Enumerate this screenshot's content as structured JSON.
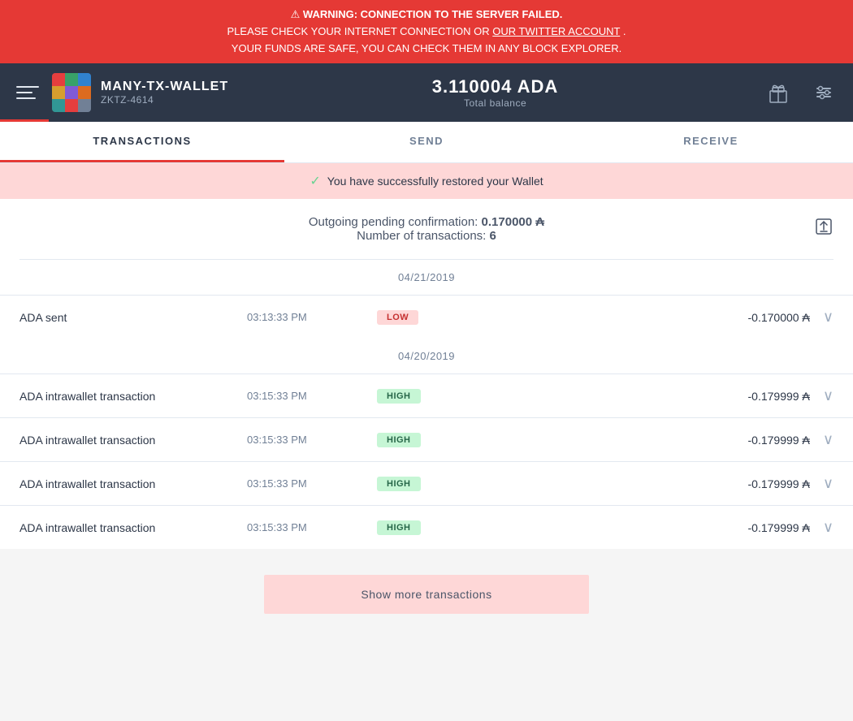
{
  "warning": {
    "icon": "⚠",
    "title": "WARNING: CONNECTION TO THE SERVER FAILED.",
    "line2_prefix": "PLEASE CHECK YOUR INTERNET CONNECTION OR ",
    "line2_link": "OUR TWITTER ACCOUNT",
    "line2_suffix": ".",
    "line3": "YOUR FUNDS ARE SAFE, YOU CAN CHECK THEM IN ANY BLOCK EXPLORER."
  },
  "header": {
    "wallet_name": "MANY-TX-WALLET",
    "wallet_id": "ZKTZ-4614",
    "balance": "3.110004 ADA",
    "balance_label": "Total balance"
  },
  "nav": {
    "tabs": [
      {
        "id": "transactions",
        "label": "TRANSACTIONS",
        "active": true
      },
      {
        "id": "send",
        "label": "SEND",
        "active": false
      },
      {
        "id": "receive",
        "label": "RECEIVE",
        "active": false
      }
    ]
  },
  "success_banner": {
    "message": "You have successfully restored your Wallet"
  },
  "pending": {
    "label": "Outgoing pending confirmation:",
    "amount": "0.170000",
    "ada_symbol": "₳",
    "tx_label": "Number of transactions:",
    "tx_count": "6"
  },
  "date_groups": [
    {
      "date": "04/21/2019",
      "transactions": [
        {
          "name": "ADA sent",
          "time": "03:13:33 PM",
          "badge": "LOW",
          "badge_type": "low",
          "amount": "-0.170000 ₳"
        }
      ]
    },
    {
      "date": "04/20/2019",
      "transactions": [
        {
          "name": "ADA intrawallet transaction",
          "time": "03:15:33 PM",
          "badge": "HIGH",
          "badge_type": "high",
          "amount": "-0.179999 ₳"
        },
        {
          "name": "ADA intrawallet transaction",
          "time": "03:15:33 PM",
          "badge": "HIGH",
          "badge_type": "high",
          "amount": "-0.179999 ₳"
        },
        {
          "name": "ADA intrawallet transaction",
          "time": "03:15:33 PM",
          "badge": "HIGH",
          "badge_type": "high",
          "amount": "-0.179999 ₳"
        },
        {
          "name": "ADA intrawallet transaction",
          "time": "03:15:33 PM",
          "badge": "HIGH",
          "badge_type": "high",
          "amount": "-0.179999 ₳"
        }
      ]
    }
  ],
  "show_more_btn": "Show more transactions",
  "icons": {
    "menu": "≡",
    "export": "⬆",
    "settings": "⚙",
    "rewards": "🎁",
    "chevron_down": "∨",
    "check": "✓"
  },
  "avatar_colors": [
    "#e53e3e",
    "#38a169",
    "#3182ce",
    "#d69e2e",
    "#805ad5",
    "#dd6b20",
    "#319795",
    "#e53e3e",
    "#718096"
  ]
}
